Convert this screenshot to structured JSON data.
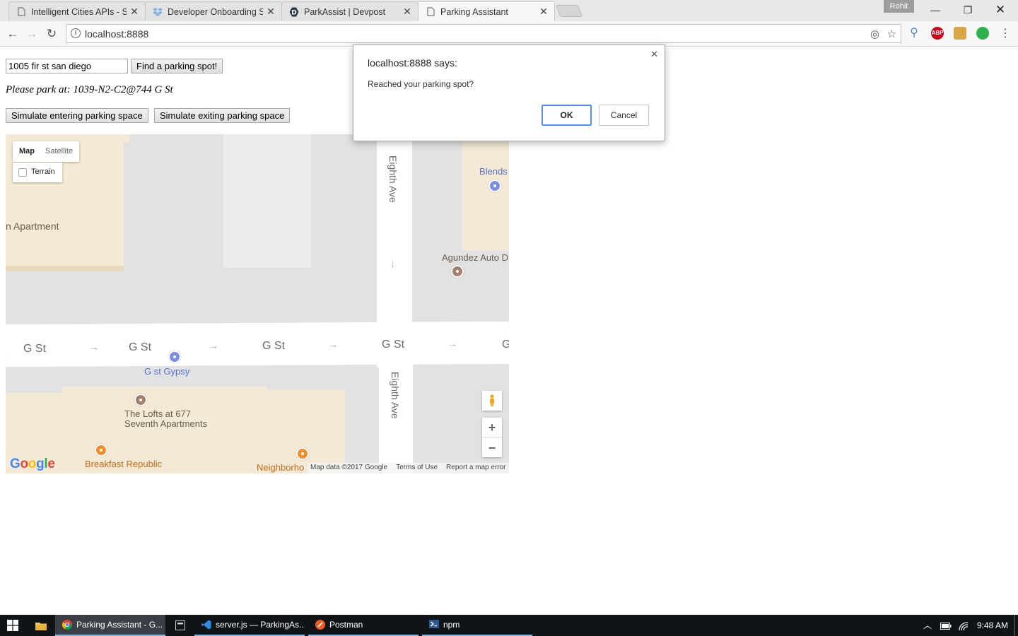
{
  "browser": {
    "tabs": [
      {
        "title": "Intelligent Cities APIs - S",
        "icon": "document-icon",
        "active": false
      },
      {
        "title": "Developer Onboarding S",
        "icon": "dropbox-icon",
        "active": false
      },
      {
        "title": "ParkAssist | Devpost",
        "icon": "devpost-icon",
        "active": false
      },
      {
        "title": "Parking Assistant",
        "icon": "document-icon",
        "active": true
      }
    ],
    "profile_name": "Rohit",
    "url": "localhost:8888",
    "extensions": [
      "link-extension-icon",
      "adblock-icon",
      "extension-icon",
      "green-dot-icon"
    ],
    "adblock_label": "ABP"
  },
  "page": {
    "address_value": "1005 fir st san diego",
    "find_button": "Find a parking spot!",
    "park_message": "Please park at: 1039-N2-C2@744 G St",
    "enter_button": "Simulate entering parking space",
    "exit_button": "Simulate exiting parking space"
  },
  "map": {
    "type_map": "Map",
    "type_satellite": "Satellite",
    "terrain_label": "Terrain",
    "streets": {
      "g_st": "G St",
      "eighth_ave": "Eighth Ave"
    },
    "places": {
      "apartment": "n Apartment",
      "blends": "Blends",
      "agundez": "Agundez Auto D",
      "gypsy": "G st Gypsy",
      "lofts_line1": "The Lofts at 677",
      "lofts_line2": "Seventh Apartments",
      "breakfast": "Breakfast Republic",
      "neighborhood": "Neighborho"
    },
    "logo": "Google",
    "attribution": {
      "map_data": "Map data ©2017 Google",
      "terms": "Terms of Use",
      "report": "Report a map error"
    },
    "colors": {
      "building": "#f3e9d4",
      "ground": "#e2e2e2",
      "road": "#ffffff",
      "poi_shopping": "#7b8ee0",
      "poi_generic": "#a5806a",
      "poi_food": "#f08e2b"
    }
  },
  "dialog": {
    "title": "localhost:8888 says:",
    "message": "Reached your parking spot?",
    "ok": "OK",
    "cancel": "Cancel"
  },
  "taskbar": {
    "items": [
      {
        "label": "Parking Assistant - G...",
        "icon": "chrome-icon"
      },
      {
        "label": "server.js — ParkingAs...",
        "icon": "vscode-icon"
      },
      {
        "label": "Postman",
        "icon": "postman-icon"
      },
      {
        "label": "npm",
        "icon": "powershell-icon"
      }
    ],
    "clock": "9:48 AM"
  }
}
